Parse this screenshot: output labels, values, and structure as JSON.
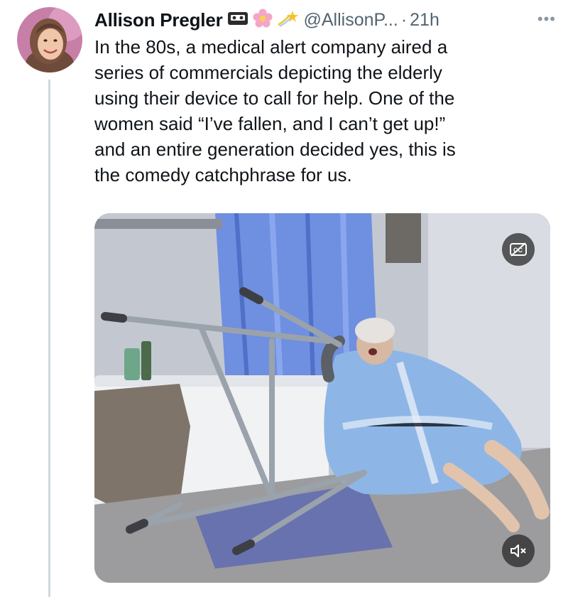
{
  "tweet": {
    "author_name": "Allison Pregler",
    "handle": "@AllisonP...",
    "separator": "·",
    "time": "21h",
    "more_label": "•••",
    "text": "In the 80s, a medical alert company aired a\nseries of commercials depicting the elderly\nusing their device to call for help. One of the\nwomen said “I’ve fallen, and I can’t get up!”\nand an entire generation decided yes, this is\nthe comedy catchphrase for us.",
    "badges": [
      "vhs-tape-icon",
      "flower-icon",
      "shooting-star-icon"
    ]
  },
  "media": {
    "type": "video",
    "cc_icon": "closed-captions-off-icon",
    "mute_icon": "speaker-muted-icon"
  },
  "colors": {
    "text": "#0f1419",
    "secondary": "#536471",
    "thread_line": "#cfd9de",
    "avatar_bg": "#c77fa8"
  }
}
